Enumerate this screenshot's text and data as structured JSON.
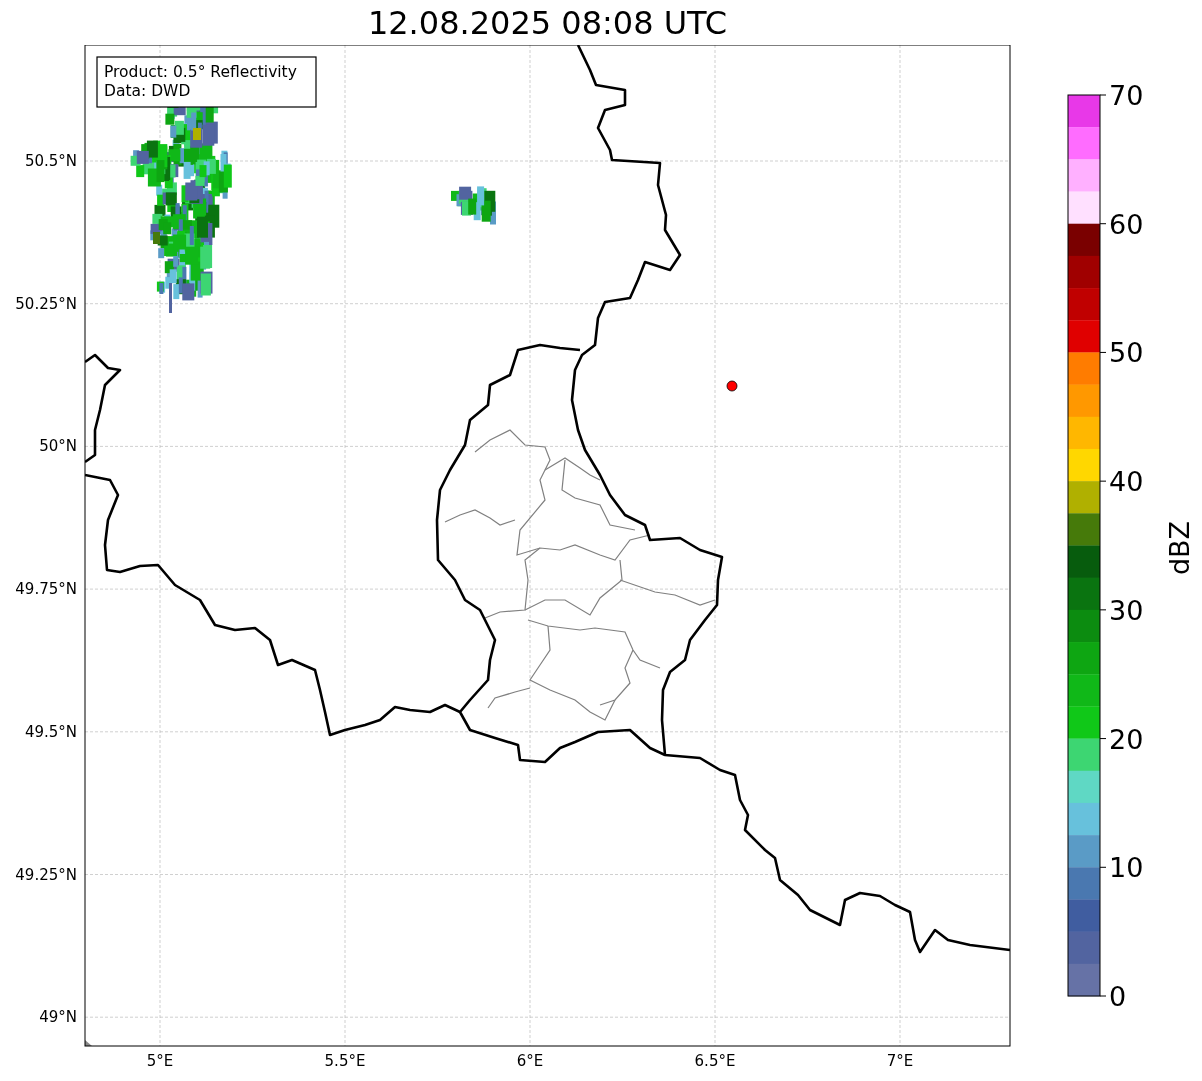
{
  "title": "12.08.2025 08:08 UTC",
  "legend": [
    "Product: 0.5° Reflectivity",
    "Data: DWD"
  ],
  "map": {
    "lon_ticks": [
      "5°E",
      "5.5°E",
      "6°E",
      "6.5°E",
      "7°E"
    ],
    "lat_ticks": [
      "50.5°N",
      "50.25°N",
      "50°N",
      "49.75°N",
      "49.5°N",
      "49.25°N",
      "49°N"
    ]
  },
  "colorbar": {
    "label": "dBZ",
    "ticks": [
      "70",
      "60",
      "50",
      "40",
      "30",
      "20",
      "10",
      "0"
    ],
    "bins": [
      {
        "color": "#e838e8"
      },
      {
        "color": "#ff6cff"
      },
      {
        "color": "#ffb0ff"
      },
      {
        "color": "#ffe0ff"
      },
      {
        "color": "#7a0000"
      },
      {
        "color": "#a00000"
      },
      {
        "color": "#c00000"
      },
      {
        "color": "#e00000"
      },
      {
        "color": "#ff7c00"
      },
      {
        "color": "#ff9800"
      },
      {
        "color": "#ffb700"
      },
      {
        "color": "#ffd700"
      },
      {
        "color": "#b0b000"
      },
      {
        "color": "#467a0a"
      },
      {
        "color": "#075c0d"
      },
      {
        "color": "#0a7410"
      },
      {
        "color": "#0c8c10"
      },
      {
        "color": "#0ea612"
      },
      {
        "color": "#10b818"
      },
      {
        "color": "#10c818"
      },
      {
        "color": "#3dd672"
      },
      {
        "color": "#5fd8c4"
      },
      {
        "color": "#67c1dc"
      },
      {
        "color": "#5a9bc6"
      },
      {
        "color": "#4a78b0"
      },
      {
        "color": "#405da0"
      },
      {
        "color": "#5264a0"
      },
      {
        "color": "#6672a6"
      }
    ]
  }
}
